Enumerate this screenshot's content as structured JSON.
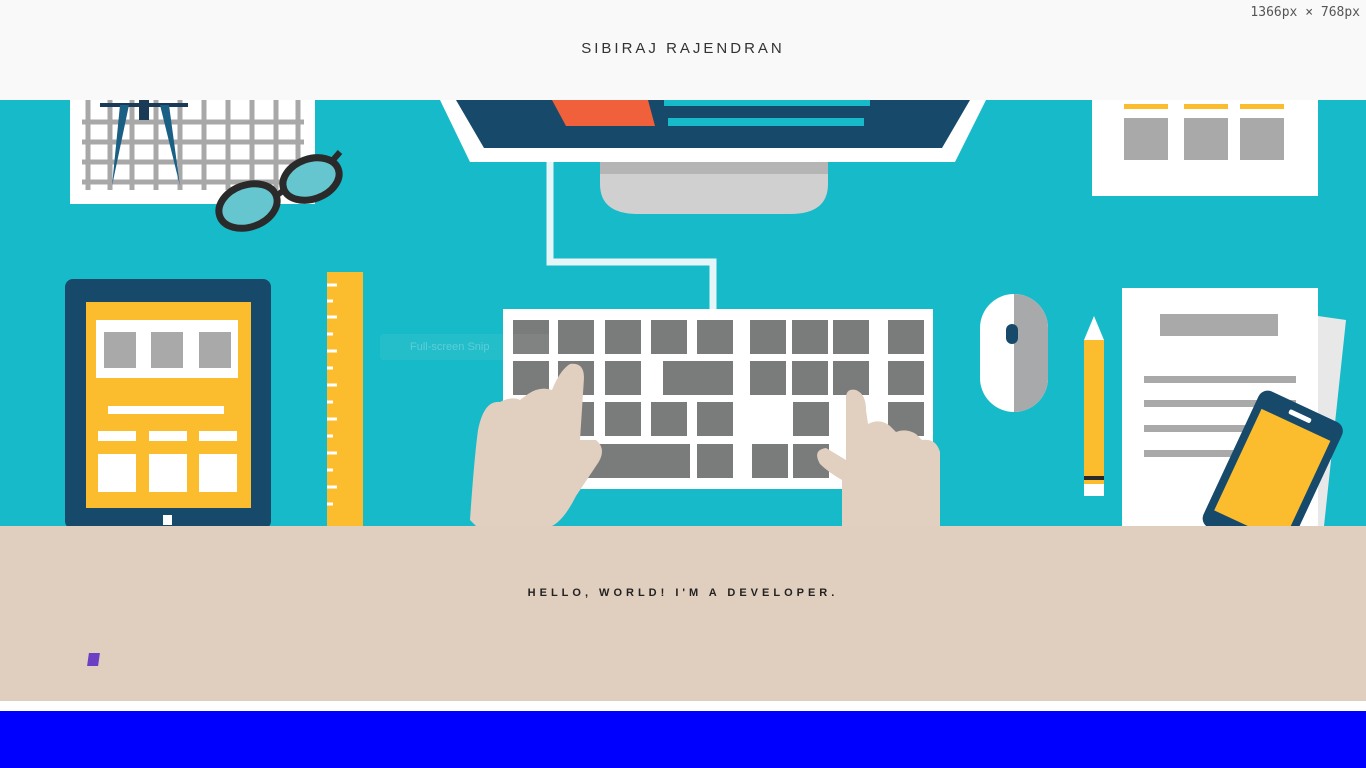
{
  "header": {
    "brand": "SIBIRAJ RAJENDRAN"
  },
  "viewport_badge": "1366px × 768px",
  "hero": {
    "illustration": "developer-desk-illustration",
    "tooltip_text": "Full-screen Snip",
    "colors": {
      "background": "#17bac8",
      "accent_yellow": "#fbbd2e",
      "dark_blue": "#174a6a",
      "orange": "#f0603a"
    }
  },
  "intro": {
    "tagline": "HELLO, WORLD! I'M A DEVELOPER."
  },
  "colors": {
    "band": "#e0cebf",
    "footer": "#0000ff"
  }
}
